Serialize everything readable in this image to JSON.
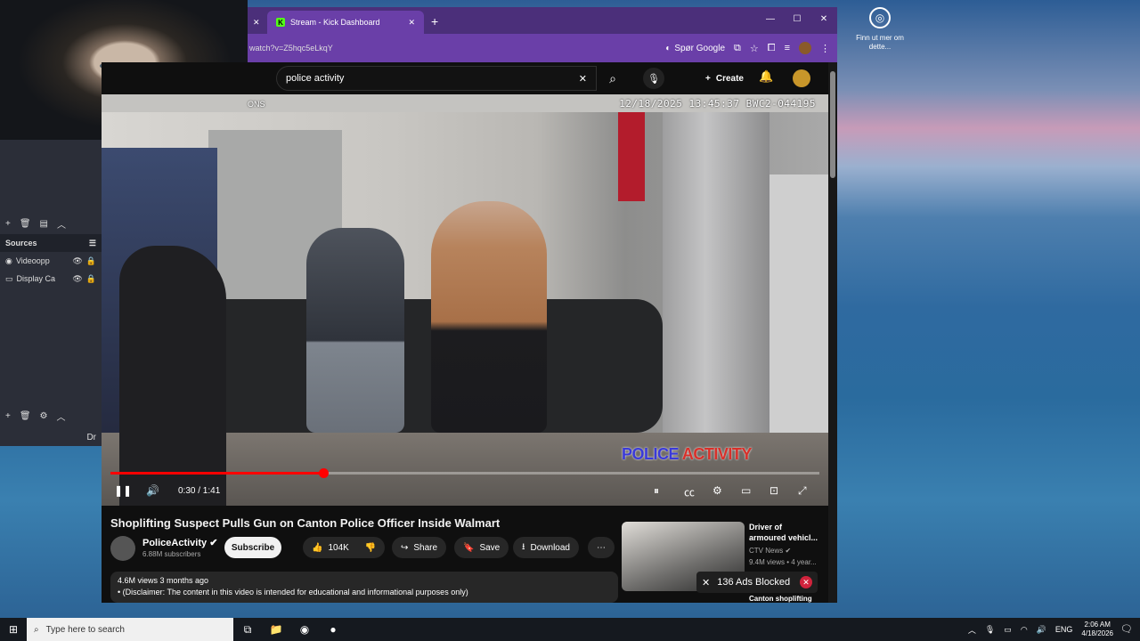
{
  "desktop": {
    "icon_label": "Finn ut mer om dette..."
  },
  "obs": {
    "sources_title": "Sources",
    "sources": [
      {
        "name": "Videoopp"
      },
      {
        "name": "Display Ca"
      }
    ],
    "tail_text": "Dr"
  },
  "browser": {
    "tab_title": "Stream - Kick Dashboard",
    "url": "watch?v=Z5hqc5eLkqY",
    "google_label": "Spør Google"
  },
  "youtube": {
    "search_query": "police activity",
    "create_label": "Create",
    "video": {
      "stamp": "12/18/2025 13:45:37   BWC2-044195",
      "stamp_left": "ONS",
      "watermark_a": "POLICE",
      "watermark_b": "ACTIVITY",
      "time": "0:30 / 1:41",
      "progress": 0.3
    },
    "title": "Shoplifting Suspect Pulls Gun on Canton Police Officer Inside Walmart",
    "channel": "PoliceActivity",
    "subscribers": "6.88M subscribers",
    "subscribe_label": "Subscribe",
    "likes": "104K",
    "share_label": "Share",
    "save_label": "Save",
    "download_label": "Download",
    "views_line": "4.6M views  3 months ago",
    "desc_line": "• (Disclaimer: The content in this video is intended for educational and informational purposes only)",
    "recommendation": {
      "title": "Driver of armoured vehicl...",
      "channel": "CTV News",
      "meta": "9.4M views • 4 year..."
    },
    "recommendation2_title": "Canton shoplifting",
    "ads_blocked": "136 Ads Blocked"
  },
  "taskbar": {
    "search_placeholder": "Type here to search",
    "lang": "ENG",
    "time": "2:06 AM",
    "date": "4/18/2026"
  }
}
